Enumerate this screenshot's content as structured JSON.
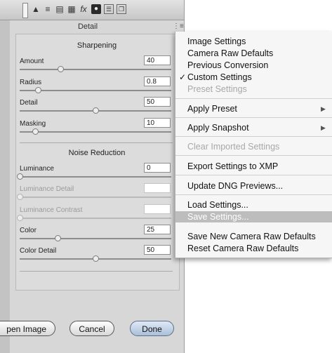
{
  "panel": {
    "tab_title": "Detail",
    "sharpening": {
      "title": "Sharpening",
      "rows": [
        {
          "label": "Amount",
          "value": "40",
          "level": 0.27
        },
        {
          "label": "Radius",
          "value": "0.8",
          "level": 0.12
        },
        {
          "label": "Detail",
          "value": "50",
          "level": 0.5
        },
        {
          "label": "Masking",
          "value": "10",
          "level": 0.1
        }
      ]
    },
    "noise": {
      "title": "Noise Reduction",
      "rows": [
        {
          "label": "Luminance",
          "value": "0",
          "level": 0.0,
          "enabled": true
        },
        {
          "label": "Luminance Detail",
          "value": "",
          "level": 0.0,
          "enabled": false
        },
        {
          "label": "Luminance Contrast",
          "value": "",
          "level": 0.0,
          "enabled": false
        },
        {
          "label": "Color",
          "value": "25",
          "level": 0.25,
          "enabled": true
        },
        {
          "label": "Color Detail",
          "value": "50",
          "level": 0.5,
          "enabled": true
        }
      ]
    },
    "buttons": {
      "open": "pen Image",
      "cancel": "Cancel",
      "done": "Done"
    }
  },
  "menu": {
    "items": [
      {
        "label": "Image Settings"
      },
      {
        "label": "Camera Raw Defaults"
      },
      {
        "label": "Previous Conversion"
      },
      {
        "label": "Custom Settings",
        "checked": true
      },
      {
        "label": "Preset Settings",
        "disabled": true
      },
      {
        "label": "Apply Preset",
        "submenu": true
      },
      {
        "label": "Apply Snapshot",
        "submenu": true
      },
      {
        "label": "Clear Imported Settings",
        "disabled": true
      },
      {
        "label": "Export Settings to XMP"
      },
      {
        "label": "Update DNG Previews..."
      },
      {
        "label": "Load Settings..."
      },
      {
        "label": "Save Settings...",
        "highlighted": true
      },
      {
        "label": "Save New Camera Raw Defaults"
      },
      {
        "label": "Reset Camera Raw Defaults"
      }
    ],
    "checkmark": "✓",
    "submenu_arrow": "▶"
  },
  "icons": {
    "toolbar": [
      "eye-dropper-icon",
      "mountain-icon",
      "histogram-icon",
      "split-tone-icon",
      "lens-icon",
      "fx-icon",
      "camera-icon",
      "presets-icon",
      "snapshots-icon"
    ]
  },
  "colors": {
    "highlight": "#bdbdbd",
    "done_button": "#a9bfd9"
  }
}
